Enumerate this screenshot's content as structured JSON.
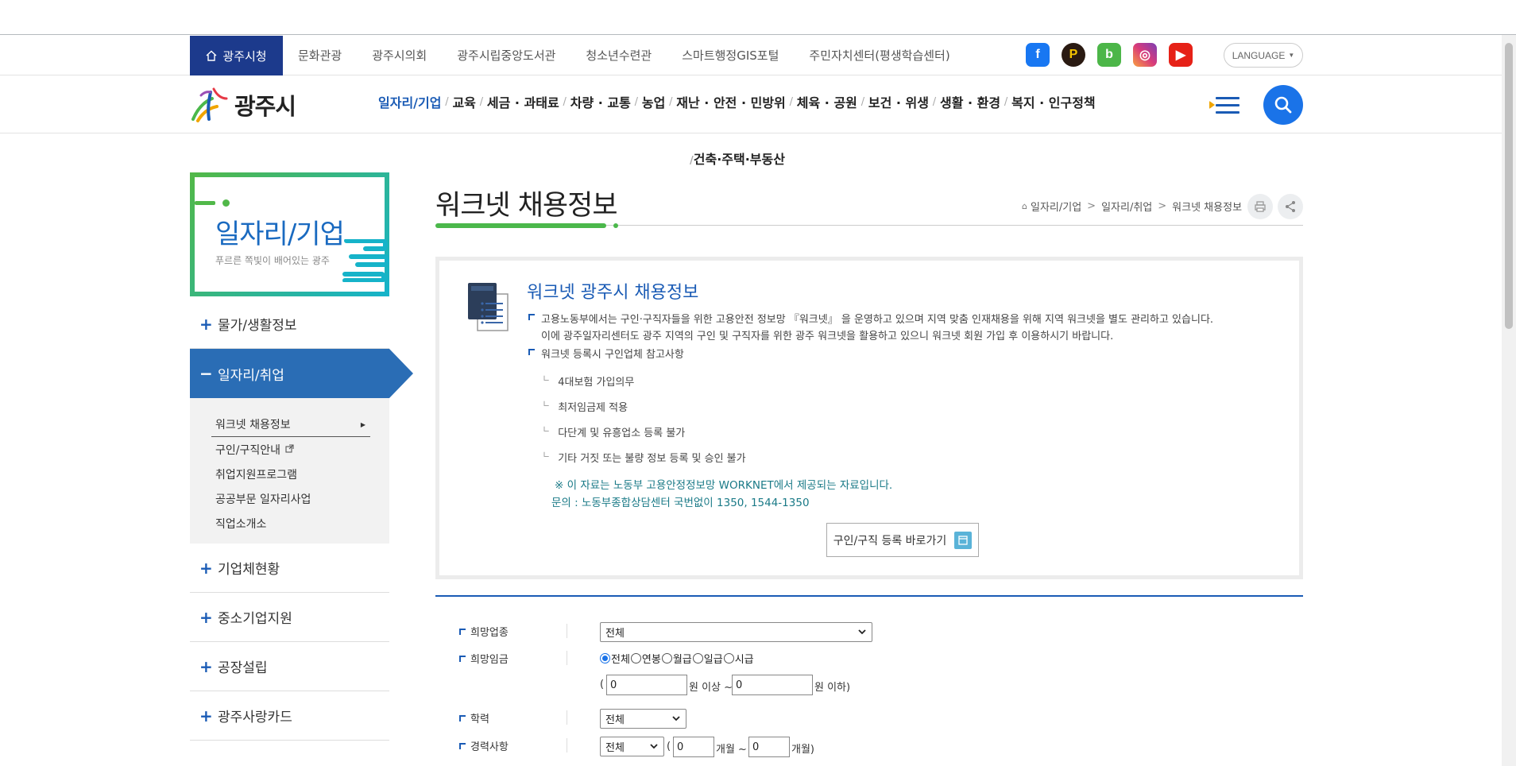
{
  "util_bar": {
    "home_label": "광주시청",
    "links": [
      "문화관광",
      "광주시의회",
      "광주시립중앙도서관",
      "청소년수련관",
      "스마트행정GIS포털",
      "주민자치센터(평생학습센터)"
    ],
    "social": [
      {
        "name": "facebook",
        "glyph": "f",
        "color": "#1877f2"
      },
      {
        "name": "blog-p",
        "glyph": "P",
        "color": "#2a1a12"
      },
      {
        "name": "band",
        "glyph": "b",
        "color": "#4cb648"
      },
      {
        "name": "instagram",
        "glyph": "◎",
        "color": "#d93b7a"
      },
      {
        "name": "youtube",
        "glyph": "▶",
        "color": "#e62117"
      }
    ],
    "language_label": "LANGUAGE"
  },
  "header": {
    "logo_text": "광주시",
    "gnb": [
      "일자리/기업",
      "교육",
      "세금 · 과태료",
      "차량 · 교통",
      "농업",
      "재난 · 안전 · 민방위",
      "체육 · 공원",
      "보건 · 위생",
      "생활 · 환경",
      "복지 · 인구정책"
    ],
    "gnb_row2": "건축·주택·부동산",
    "active_index": 0
  },
  "sidebar": {
    "title": "일자리/기업",
    "subtitle": "푸르른 쪽빛이 배어있는 광주",
    "menu_top": [
      {
        "label": "물가/생활정보",
        "state": "+"
      }
    ],
    "menu_active": {
      "label": "일자리/취업",
      "state": "−"
    },
    "submenu": [
      "워크넷 채용정보",
      "구인/구직안내",
      "취업지원프로그램",
      "공공부문 일자리사업",
      "직업소개소"
    ],
    "menu_bottom": [
      {
        "label": "기업체현황",
        "state": "+"
      },
      {
        "label": "중소기업지원",
        "state": "+"
      },
      {
        "label": "공장설립",
        "state": "+"
      },
      {
        "label": "광주사랑카드",
        "state": "+"
      }
    ]
  },
  "page": {
    "title": "워크넷 채용정보",
    "breadcrumb": [
      "일자리/기업",
      "일자리/취업",
      "워크넷 채용정보"
    ]
  },
  "info": {
    "heading": "워크넷 광주시 채용정보",
    "para1_line1": "고용노동부에서는 구인·구직자들을 위한 고용안전 정보망 『워크넷』 을 운영하고 있으며 지역 맞춤 인재채용을 위해 지역 워크넷을 별도 관리하고 있습니다.",
    "para1_line2": "이에 광주일자리센터도 광주 지역의 구인 및 구직자를 위한 광주 워크넷을 활용하고 있으니 워크넷 회원 가입 후 이용하시기 바랍니다.",
    "para2": "워크넷 등록시 구인업체 참고사항",
    "items": [
      "4대보험 가입의무",
      "최저임금제 적용",
      "다단계 및 유흥업소 등록 불가",
      "기타 거짓 또는 불량 정보 등록 및 승인 불가"
    ],
    "note1": "※ 이 자료는 노동부 고용안정정보망 WORKNET에서 제공되는 자료입니다.",
    "note2": "문의 : 노동부종합상담센터 국번없이 1350, 1544-1350",
    "button": "구인/구직 등록 바로가기"
  },
  "form": {
    "industry_label": "희망업종",
    "industry_value": "전체",
    "wage_label": "희망임금",
    "wage_options": [
      "전체",
      "연봉",
      "월급",
      "일급",
      "시급"
    ],
    "wage_selected": 0,
    "wage_min": "0",
    "wage_min_suffix": "원 이상 ~",
    "wage_max": "0",
    "wage_max_suffix": "원 이하)",
    "open_paren": "(",
    "edu_label": "학력",
    "edu_value": "전체",
    "career_label": "경력사항",
    "career_value": "전체",
    "career_min": "0",
    "career_min_suffix": "개월 ~",
    "career_max": "0",
    "career_max_suffix": "개월)"
  }
}
